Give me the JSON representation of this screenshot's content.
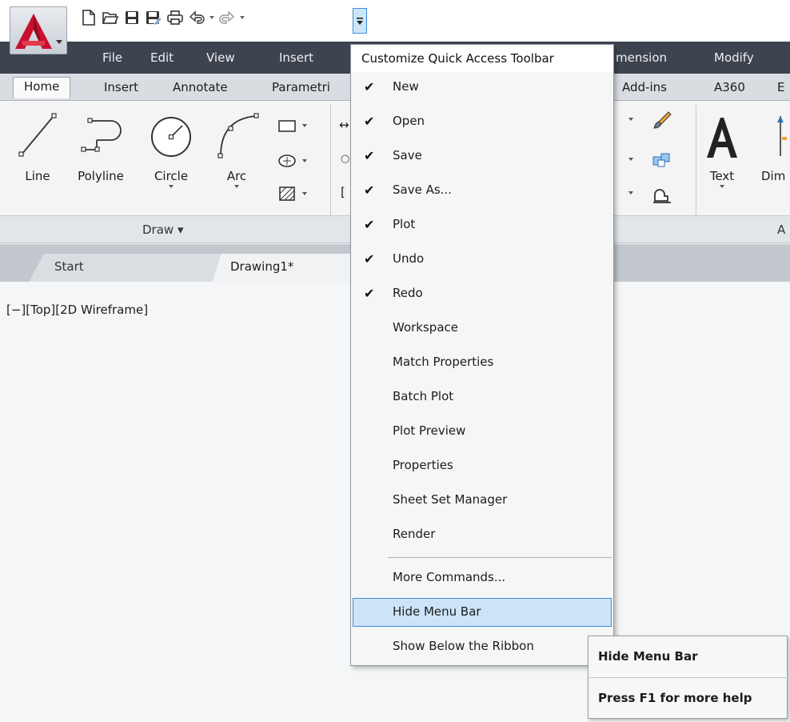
{
  "qat": {
    "buttons": [
      "new-icon",
      "open-icon",
      "save-icon",
      "save-as-icon",
      "plot-icon",
      "undo-icon",
      "redo-icon"
    ],
    "customize_icon": "customize-qat-icon"
  },
  "menubar": {
    "items": [
      "File",
      "Edit",
      "View",
      "Insert",
      "mension",
      "Modify"
    ]
  },
  "ribbon": {
    "tabs": [
      "Home",
      "Insert",
      "Annotate",
      "Parametri",
      "Add-ins",
      "A360",
      "E"
    ],
    "tools": [
      "Line",
      "Polyline",
      "Circle",
      "Arc"
    ],
    "annotate_tools": [
      "Text",
      "Dim"
    ],
    "panel_draw": "Draw",
    "panel_an": "A"
  },
  "file_tabs": {
    "start": "Start",
    "drawing": "Drawing1*"
  },
  "viewport": {
    "label": "[−][Top][2D Wireframe]"
  },
  "qat_menu": {
    "title": "Customize Quick Access Toolbar",
    "items": [
      {
        "label": "New",
        "checked": "✔"
      },
      {
        "label": "Open",
        "checked": "✔"
      },
      {
        "label": "Save",
        "checked": "✔"
      },
      {
        "label": "Save As...",
        "checked": "✔"
      },
      {
        "label": "Plot",
        "checked": "✔"
      },
      {
        "label": "Undo",
        "checked": "✔"
      },
      {
        "label": "Redo",
        "checked": "✔"
      },
      {
        "label": "Workspace",
        "checked": ""
      },
      {
        "label": "Match Properties",
        "checked": ""
      },
      {
        "label": "Batch Plot",
        "checked": ""
      },
      {
        "label": "Plot Preview",
        "checked": ""
      },
      {
        "label": "Properties",
        "checked": ""
      },
      {
        "label": "Sheet Set Manager",
        "checked": ""
      },
      {
        "label": "Render",
        "checked": ""
      }
    ],
    "more_commands": "More Commands...",
    "hide_menu_bar": "Hide Menu Bar",
    "show_below": "Show Below the Ribbon"
  },
  "tooltip": {
    "title": "Hide Menu Bar",
    "help": "Press F1 for more help"
  },
  "colors": {
    "menubar_bg": "#3d4450",
    "hover_bg": "#cce4f7",
    "hover_border": "#3d8ed6",
    "autocad_red": "#c8102e"
  }
}
